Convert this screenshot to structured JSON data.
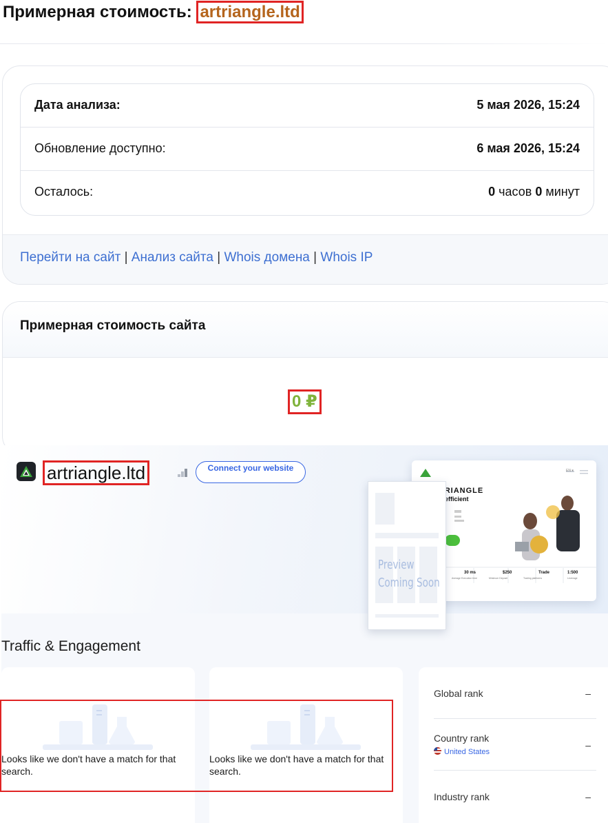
{
  "heading": {
    "prefix": "Примерная стоимость:",
    "domain": "artriangle.ltd"
  },
  "analysis": {
    "rows": [
      {
        "label": "Дата анализа:",
        "value": "5 мая 2026, 15:24"
      },
      {
        "label": "Обновление доступно:",
        "value": "6 мая 2026, 15:24"
      }
    ],
    "remaining": {
      "label": "Осталось:",
      "hours": "0",
      "hours_unit": "часов",
      "minutes": "0",
      "minutes_unit": "минут"
    }
  },
  "links": [
    {
      "label": "Перейти на сайт"
    },
    {
      "label": "Анализ сайта"
    },
    {
      "label": "Whois домена"
    },
    {
      "label": "Whois IP"
    }
  ],
  "link_separator": "|",
  "value_card": {
    "title": "Примерная стоимость сайта",
    "price": "0 ₽"
  },
  "similarweb": {
    "domain": "artriangle.ltd",
    "connect_button": "Connect your website",
    "preview": {
      "line1": "Preview",
      "line2": "Coming Soon"
    },
    "site_screenshot": {
      "brand": "TRIANGLE",
      "tagline": "u efficient",
      "lang": "EN ▾",
      "stats": [
        {
          "value": "30 ms",
          "label": "Average Execution time"
        },
        {
          "value": "$250",
          "label": "Minimum Deposit"
        },
        {
          "value": "Trade",
          "label": "Trading platforms"
        },
        {
          "value": "1:500",
          "label": "Leverage"
        }
      ]
    },
    "traffic_title": "Traffic & Engagement",
    "no_match": "Looks like we don't have a match for that search.",
    "ranks": [
      {
        "label": "Global rank",
        "value": "–"
      },
      {
        "label": "Country rank",
        "sub": "United States",
        "value": "–"
      },
      {
        "label": "Industry rank",
        "value": "–"
      }
    ]
  },
  "colors": {
    "link": "#3d6fd1",
    "domain_accent": "#b5651d",
    "price": "#7fb33b",
    "highlight_box": "#e02424",
    "sw_blue": "#3866e3"
  }
}
